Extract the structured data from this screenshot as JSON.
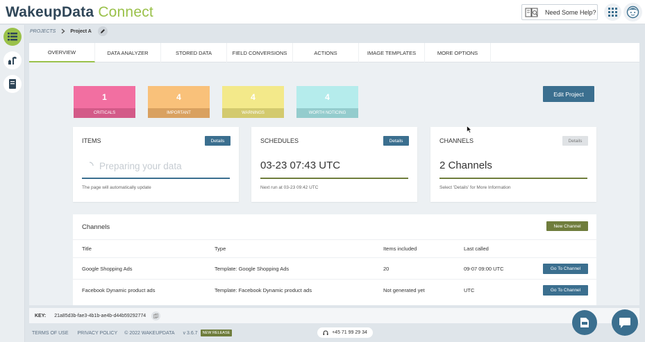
{
  "header": {
    "logo_part1": "WakeupData",
    "logo_part2": "Connect",
    "help_label": "Need Some Help?"
  },
  "breadcrumb": {
    "root": "PROJECTS",
    "current": "Project A"
  },
  "tabs": [
    {
      "label": "OVERVIEW",
      "active": true
    },
    {
      "label": "DATA ANALYZER",
      "active": false
    },
    {
      "label": "STORED DATA",
      "active": false
    },
    {
      "label": "FIELD CONVERSIONS",
      "active": false
    },
    {
      "label": "ACTIONS",
      "active": false
    },
    {
      "label": "IMAGE TEMPLATES",
      "active": false
    },
    {
      "label": "MORE OPTIONS",
      "active": false
    }
  ],
  "stats": [
    {
      "count": "1",
      "label": "CRITICALS",
      "top": "#f26fa1",
      "bottom": "#d35a88"
    },
    {
      "count": "4",
      "label": "IMPORTANT",
      "top": "#f9c17a",
      "bottom": "#d9a160"
    },
    {
      "count": "4",
      "label": "WARNINGS",
      "top": "#f3e98a",
      "bottom": "#d3ca6e"
    },
    {
      "count": "4",
      "label": "WORTH NOTICING",
      "top": "#b5ecec",
      "bottom": "#94cccd"
    }
  ],
  "edit_project_label": "Edit Project",
  "cards": {
    "items": {
      "title": "ITEMS",
      "button": "Details",
      "value": "Preparing your data",
      "note": "The page will automatically update"
    },
    "schedules": {
      "title": "SCHEDULES",
      "button": "Details",
      "value": "03-23 07:43 UTC",
      "note": "Next run at 03-23 09:42 UTC"
    },
    "channels": {
      "title": "CHANNELS",
      "button": "Details",
      "value": "2 Channels",
      "note": "Select 'Details' for More Information"
    }
  },
  "channels_table": {
    "heading": "Channels",
    "new_button": "New Channel",
    "columns": [
      "Title",
      "Type",
      "Items included",
      "Last called"
    ],
    "rows": [
      {
        "title": "Google Shopping Ads",
        "type": "Template: Google Shopping Ads",
        "items": "20",
        "last_called": "09-07 09:00 UTC",
        "action": "Go To Channel"
      },
      {
        "title": "Facebook Dynamic product ads",
        "type": "Template: Facebook Dynamic product ads",
        "items": "Not generated yet",
        "last_called": "UTC",
        "action": "Go To Channel"
      }
    ]
  },
  "keybar": {
    "key_label": "KEY:",
    "key_value": "21a85d3b-fae3-4b1b-ae4b-d44b59292774"
  },
  "footer": {
    "terms": "TERMS OF USE",
    "privacy": "PRIVACY POLICY",
    "copyright": "© 2022 WAKEUPDATA",
    "version": "v 3.6.7",
    "release_badge": "NEW RELEASE",
    "phone": "+45 71 99 29 34"
  },
  "colors": {
    "primary": "#3b6f8f",
    "accent": "#9ac14a",
    "olive": "#6f7d3c"
  }
}
